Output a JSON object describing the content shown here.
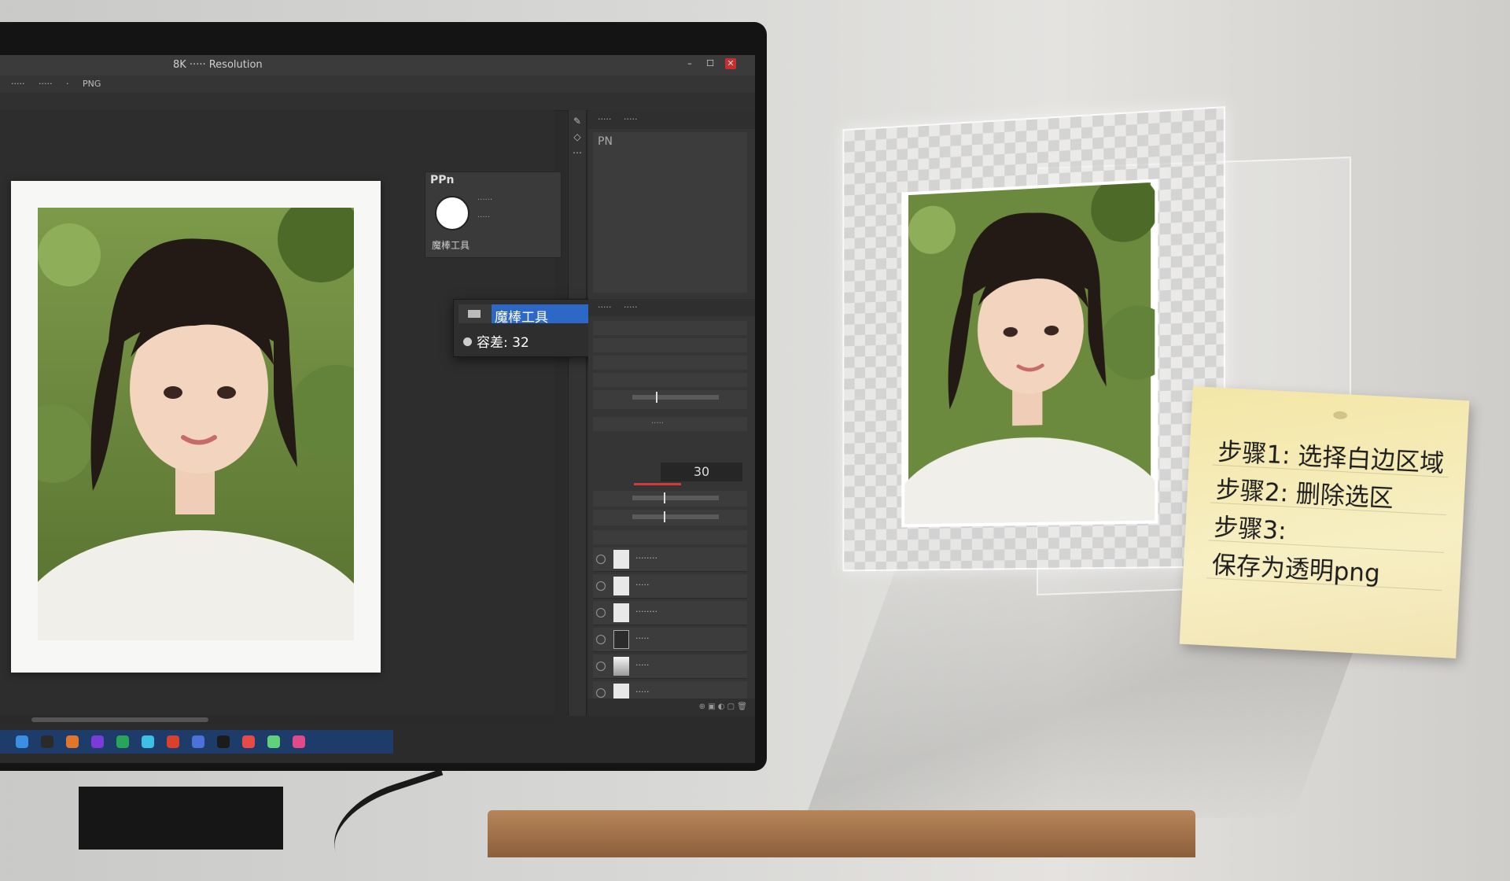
{
  "window": {
    "title": "8K ····· Resolution",
    "menu": [
      "·····",
      "·····",
      "·",
      "PNG"
    ],
    "controls": {
      "minimize": "–",
      "maximize": "☐",
      "close": "✕"
    }
  },
  "brush_panel": {
    "header": "PPn",
    "row1": "······",
    "row2": "·····",
    "footer": "魔棒工具"
  },
  "magic_wand_popup": {
    "tool_label": "魔棒工具",
    "tolerance_label": "容差: 32"
  },
  "right_panel": {
    "tabs": [
      "·····",
      "·····"
    ],
    "preview_label": "PN",
    "tabs2": [
      "·····",
      "·····"
    ],
    "opacity_value": "30",
    "blend_mode": "·····",
    "layers": [
      "········",
      "·····",
      "········",
      "·····",
      "·····",
      "·····",
      "·····"
    ]
  },
  "taskbar": {
    "icon_colors": [
      "#3a8fe0",
      "#2a2a2a",
      "#e0762b",
      "#7c3ad9",
      "#2aa35b",
      "#3ec0e6",
      "#d9412b",
      "#4a72d9",
      "#1b1b1b",
      "#e84a4a",
      "#5fd17a",
      "#e04a8a"
    ]
  },
  "sticky_note": {
    "step1": "步骤1: 选择白边区域",
    "step2": "步骤2: 删除选区",
    "step3": "步骤3:",
    "step4": "保存为透明png"
  },
  "colors": {
    "selection_blue": "#2e68c6",
    "note_paper": "#f3e6a6",
    "app_dark": "#2b2b2b"
  }
}
